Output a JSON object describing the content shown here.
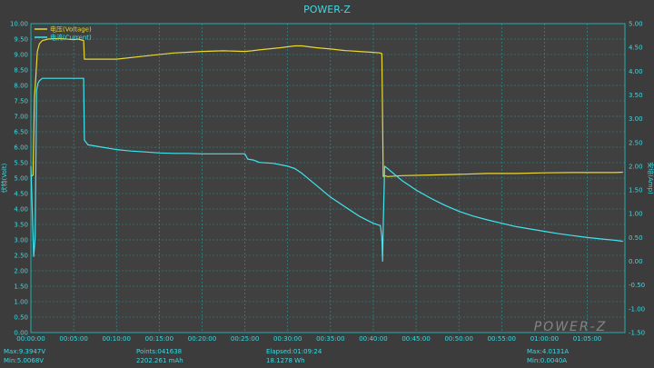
{
  "colors": {
    "background": "#3c3c3c",
    "plot_background": "#404040",
    "grid": "#1fb0b0",
    "voltage": "#e8d830",
    "current": "#40e4ee",
    "text": "#3fd8e0"
  },
  "watermark": "POWER-Z",
  "stats": {
    "max_voltage": "Max:9.3947V",
    "min_voltage": "Min:5.0068V",
    "points": "Points:041638",
    "capacity": "2202.261 mAh",
    "elapsed": "Elapsed:01:09:24",
    "energy": "18.1278 Wh",
    "max_current": "Max:4.0131A",
    "min_current": "Min:0.0040A"
  },
  "chart_data": {
    "type": "line",
    "title": "POWER-Z",
    "xlabel": "",
    "ylabel": "伏特(Volt)",
    "y2label": "安培(Amp)",
    "xlim": [
      0,
      4164
    ],
    "ylim": [
      0,
      10
    ],
    "y2lim": [
      -1.5,
      5
    ],
    "x_ticks": [
      "00:00:00",
      "00:05:00",
      "00:10:00",
      "00:15:00",
      "00:20:00",
      "00:25:00",
      "00:30:00",
      "00:35:00",
      "00:40:00",
      "00:45:00",
      "00:50:00",
      "00:55:00",
      "01:00:00",
      "01:05:00"
    ],
    "x_tick_values": [
      0,
      300,
      600,
      900,
      1200,
      1500,
      1800,
      2100,
      2400,
      2700,
      3000,
      3300,
      3600,
      3900
    ],
    "y_ticks": [
      "0.00",
      "0.50",
      "1.00",
      "1.50",
      "2.00",
      "2.50",
      "3.00",
      "3.50",
      "4.00",
      "4.50",
      "5.00",
      "5.50",
      "6.00",
      "6.50",
      "7.00",
      "7.50",
      "8.00",
      "8.50",
      "9.00",
      "9.50",
      "10.00"
    ],
    "y2_ticks": [
      "-1.50",
      "-1.00",
      "-0.50",
      "0.00",
      "0.50",
      "1.00",
      "1.50",
      "2.00",
      "2.50",
      "3.00",
      "3.50",
      "4.00",
      "4.50",
      "5.00"
    ],
    "grid": true,
    "legend_placement": "top-left",
    "series": [
      {
        "name": "电压(Voltage)",
        "axis": "left",
        "x": [
          0,
          15,
          25,
          35,
          45,
          60,
          80,
          120,
          200,
          300,
          330,
          370,
          375,
          450,
          600,
          800,
          1000,
          1200,
          1350,
          1500,
          1550,
          1600,
          1750,
          1850,
          1900,
          2000,
          2100,
          2200,
          2300,
          2400,
          2450,
          2460,
          2470,
          2480,
          2500,
          2600,
          2800,
          3000,
          3200,
          3400,
          3600,
          3800,
          3900,
          4000,
          4100,
          4150
        ],
        "values": [
          5.05,
          5.1,
          7.6,
          8.3,
          9.1,
          9.35,
          9.45,
          9.5,
          9.52,
          9.48,
          9.5,
          9.45,
          8.85,
          8.85,
          8.85,
          8.95,
          9.05,
          9.1,
          9.12,
          9.1,
          9.12,
          9.15,
          9.22,
          9.28,
          9.28,
          9.22,
          9.18,
          9.13,
          9.1,
          9.07,
          9.05,
          9.03,
          5.05,
          5.08,
          5.05,
          5.08,
          5.1,
          5.12,
          5.15,
          5.15,
          5.17,
          5.18,
          5.18,
          5.18,
          5.18,
          5.19
        ]
      },
      {
        "name": "电流(Current)",
        "axis": "right",
        "x": [
          0,
          20,
          30,
          40,
          50,
          60,
          80,
          100,
          150,
          200,
          300,
          360,
          370,
          375,
          400,
          500,
          600,
          700,
          800,
          900,
          1000,
          1100,
          1200,
          1300,
          1400,
          1500,
          1520,
          1560,
          1600,
          1700,
          1800,
          1850,
          1900,
          2000,
          2100,
          2200,
          2300,
          2400,
          2450,
          2460,
          2465,
          2470,
          2480,
          2500,
          2600,
          2700,
          2800,
          2900,
          3000,
          3100,
          3200,
          3300,
          3400,
          3500,
          3600,
          3700,
          3800,
          3900,
          4000,
          4100,
          4150
        ],
        "values": [
          2.0,
          0.1,
          0.5,
          3.6,
          3.75,
          3.8,
          3.85,
          3.85,
          3.85,
          3.85,
          3.85,
          3.85,
          3.85,
          2.55,
          2.45,
          2.4,
          2.35,
          2.32,
          2.3,
          2.28,
          2.27,
          2.27,
          2.26,
          2.26,
          2.26,
          2.26,
          2.15,
          2.13,
          2.08,
          2.06,
          2.0,
          1.95,
          1.85,
          1.6,
          1.35,
          1.15,
          0.95,
          0.8,
          0.75,
          0.5,
          0.0,
          0.75,
          2.0,
          1.95,
          1.7,
          1.5,
          1.33,
          1.18,
          1.05,
          0.95,
          0.87,
          0.8,
          0.73,
          0.68,
          0.63,
          0.58,
          0.54,
          0.5,
          0.47,
          0.44,
          0.42
        ]
      }
    ]
  }
}
